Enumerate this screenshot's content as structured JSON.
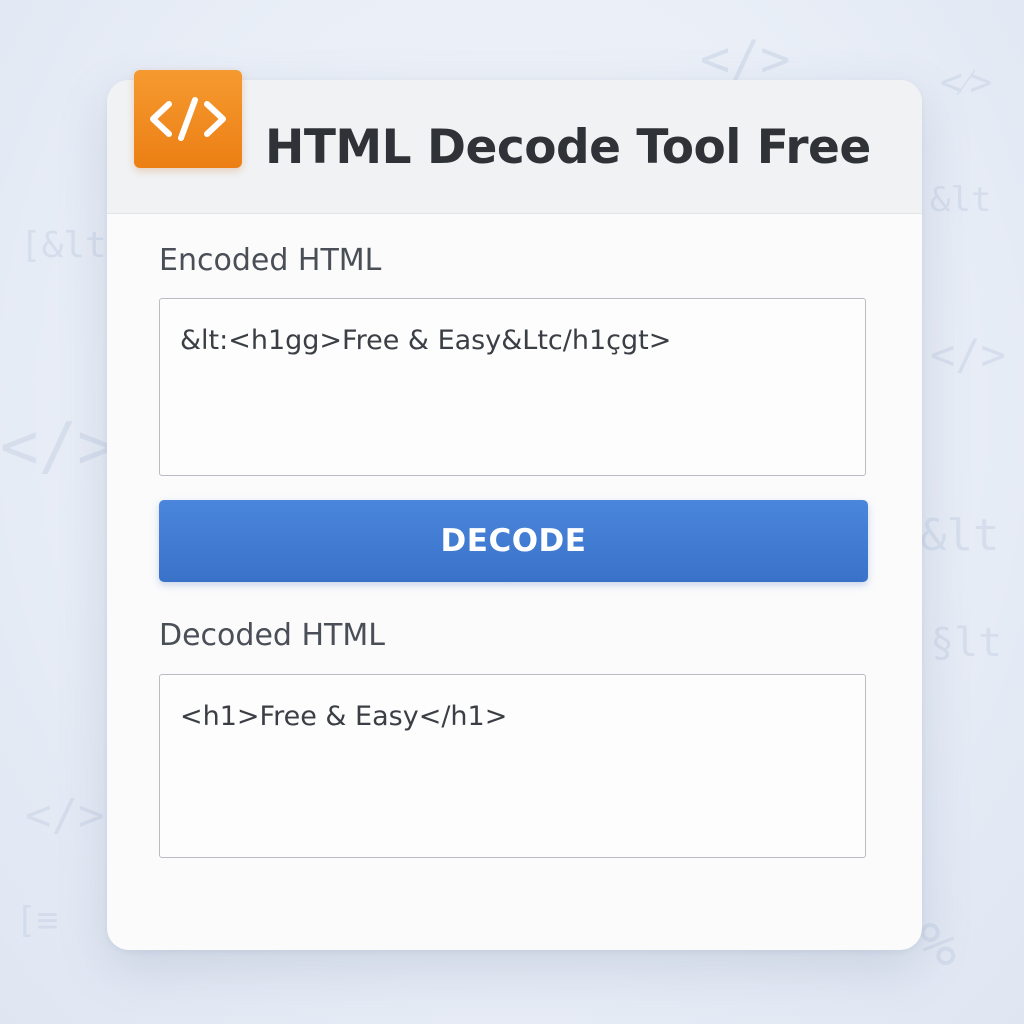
{
  "app": {
    "title": "HTML Decode Tool Free",
    "logo_icon": "code-brackets-icon",
    "logo_glyph": "</>",
    "accent_color": "#ec7f14",
    "button_color": "#3a72c9"
  },
  "encoded": {
    "label": "Encoded HTML",
    "value": "&lt:<h1gg>Free & Easy&Ltc/h1çgt>"
  },
  "action": {
    "decode_label": "DECODE"
  },
  "decoded": {
    "label": "Decoded HTML",
    "value": "<h1>Free & Easy</h1>"
  },
  "background": {
    "glyphs": [
      "</>",
      "</>",
      "<⁄>",
      "&lt",
      "</>",
      "[&lt",
      "§lt",
      "</>",
      "[≡",
      "%",
      "&lt"
    ]
  }
}
